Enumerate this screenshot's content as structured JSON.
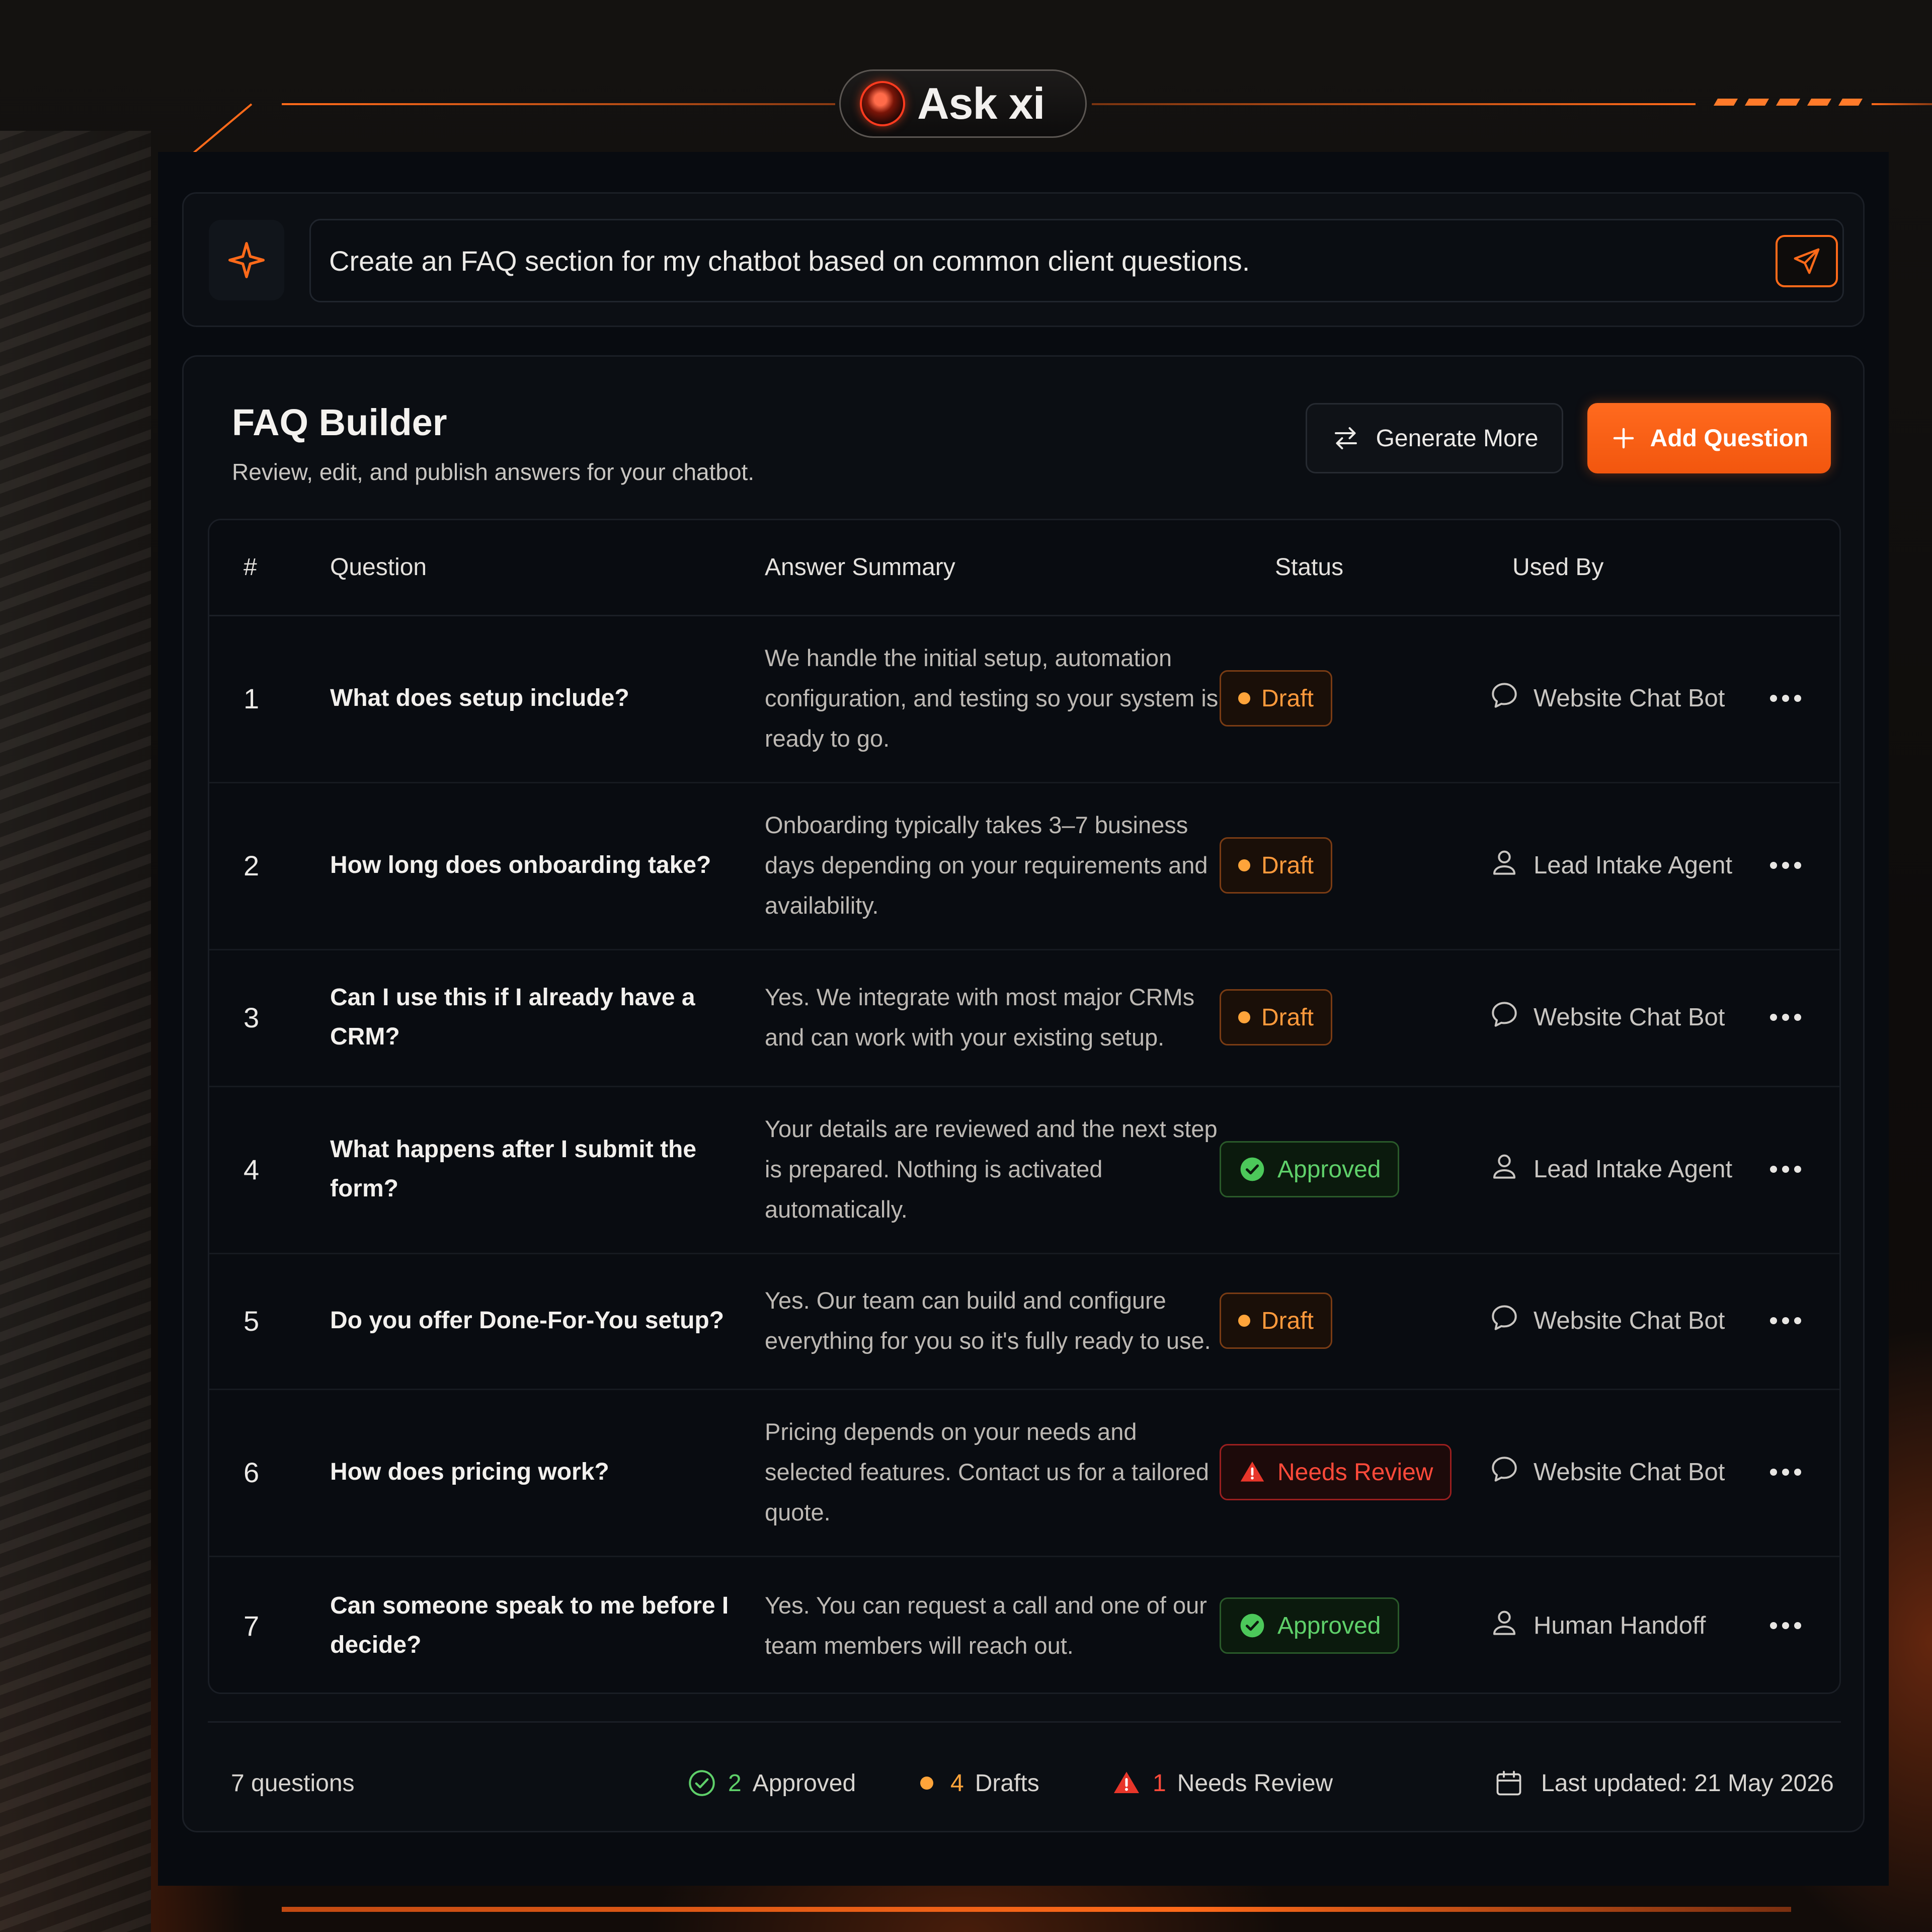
{
  "brand": {
    "name": "Ask xi"
  },
  "prompt": {
    "text": "Create an FAQ section for my chatbot based on common client questions."
  },
  "builder": {
    "title": "FAQ Builder",
    "subtitle": "Review, edit, and publish answers for your chatbot.",
    "generate_label": "Generate More",
    "add_label": "Add Question"
  },
  "table": {
    "columns": {
      "num": "#",
      "question": "Question",
      "answer": "Answer Summary",
      "status": "Status",
      "used_by": "Used By"
    },
    "rows": [
      {
        "num": "1",
        "question": "What does setup include?",
        "answer": "We handle the initial setup, automation configuration, and testing so your system is ready to go.",
        "status": "Draft",
        "used_by": "Website Chat Bot",
        "used_icon": "chat-icon"
      },
      {
        "num": "2",
        "question": "How long does onboarding take?",
        "answer": "Onboarding typically takes 3–7 business days depending on your requirements and availability.",
        "status": "Draft",
        "used_by": "Lead Intake Agent",
        "used_icon": "user-icon"
      },
      {
        "num": "3",
        "question": "Can I use this if I already have a CRM?",
        "answer": "Yes. We integrate with most major CRMs and can work with your existing setup.",
        "status": "Draft",
        "used_by": "Website Chat Bot",
        "used_icon": "chat-icon"
      },
      {
        "num": "4",
        "question": "What happens after I submit the form?",
        "answer": "Your details are reviewed and the next step is prepared. Nothing is activated automatically.",
        "status": "Approved",
        "used_by": "Lead Intake Agent",
        "used_icon": "user-icon"
      },
      {
        "num": "5",
        "question": "Do you offer Done-For-You setup?",
        "answer": "Yes. Our team can build and configure everything for you so it's fully ready to use.",
        "status": "Draft",
        "used_by": "Website Chat Bot",
        "used_icon": "chat-icon"
      },
      {
        "num": "6",
        "question": "How does pricing work?",
        "answer": "Pricing depends on your needs and selected features. Contact us for a tailored quote.",
        "status": "Needs Review",
        "used_by": "Website Chat Bot",
        "used_icon": "chat-icon"
      },
      {
        "num": "7",
        "question": "Can someone speak to me before I decide?",
        "answer": "Yes. You can request a call and one of our team members will reach out.",
        "status": "Approved",
        "used_by": "Human Handoff",
        "used_icon": "user-icon"
      }
    ]
  },
  "footer": {
    "total": "7 questions",
    "approved_count": "2",
    "approved_label": "Approved",
    "drafts_count": "4",
    "drafts_label": "Drafts",
    "review_count": "1",
    "review_label": "Needs Review",
    "updated": "Last updated: 21 May 2026"
  },
  "colors": {
    "accent": "#ff6a1a",
    "approved": "#5fd06a",
    "draft": "#ffa43a",
    "review": "#ff4a3a"
  }
}
